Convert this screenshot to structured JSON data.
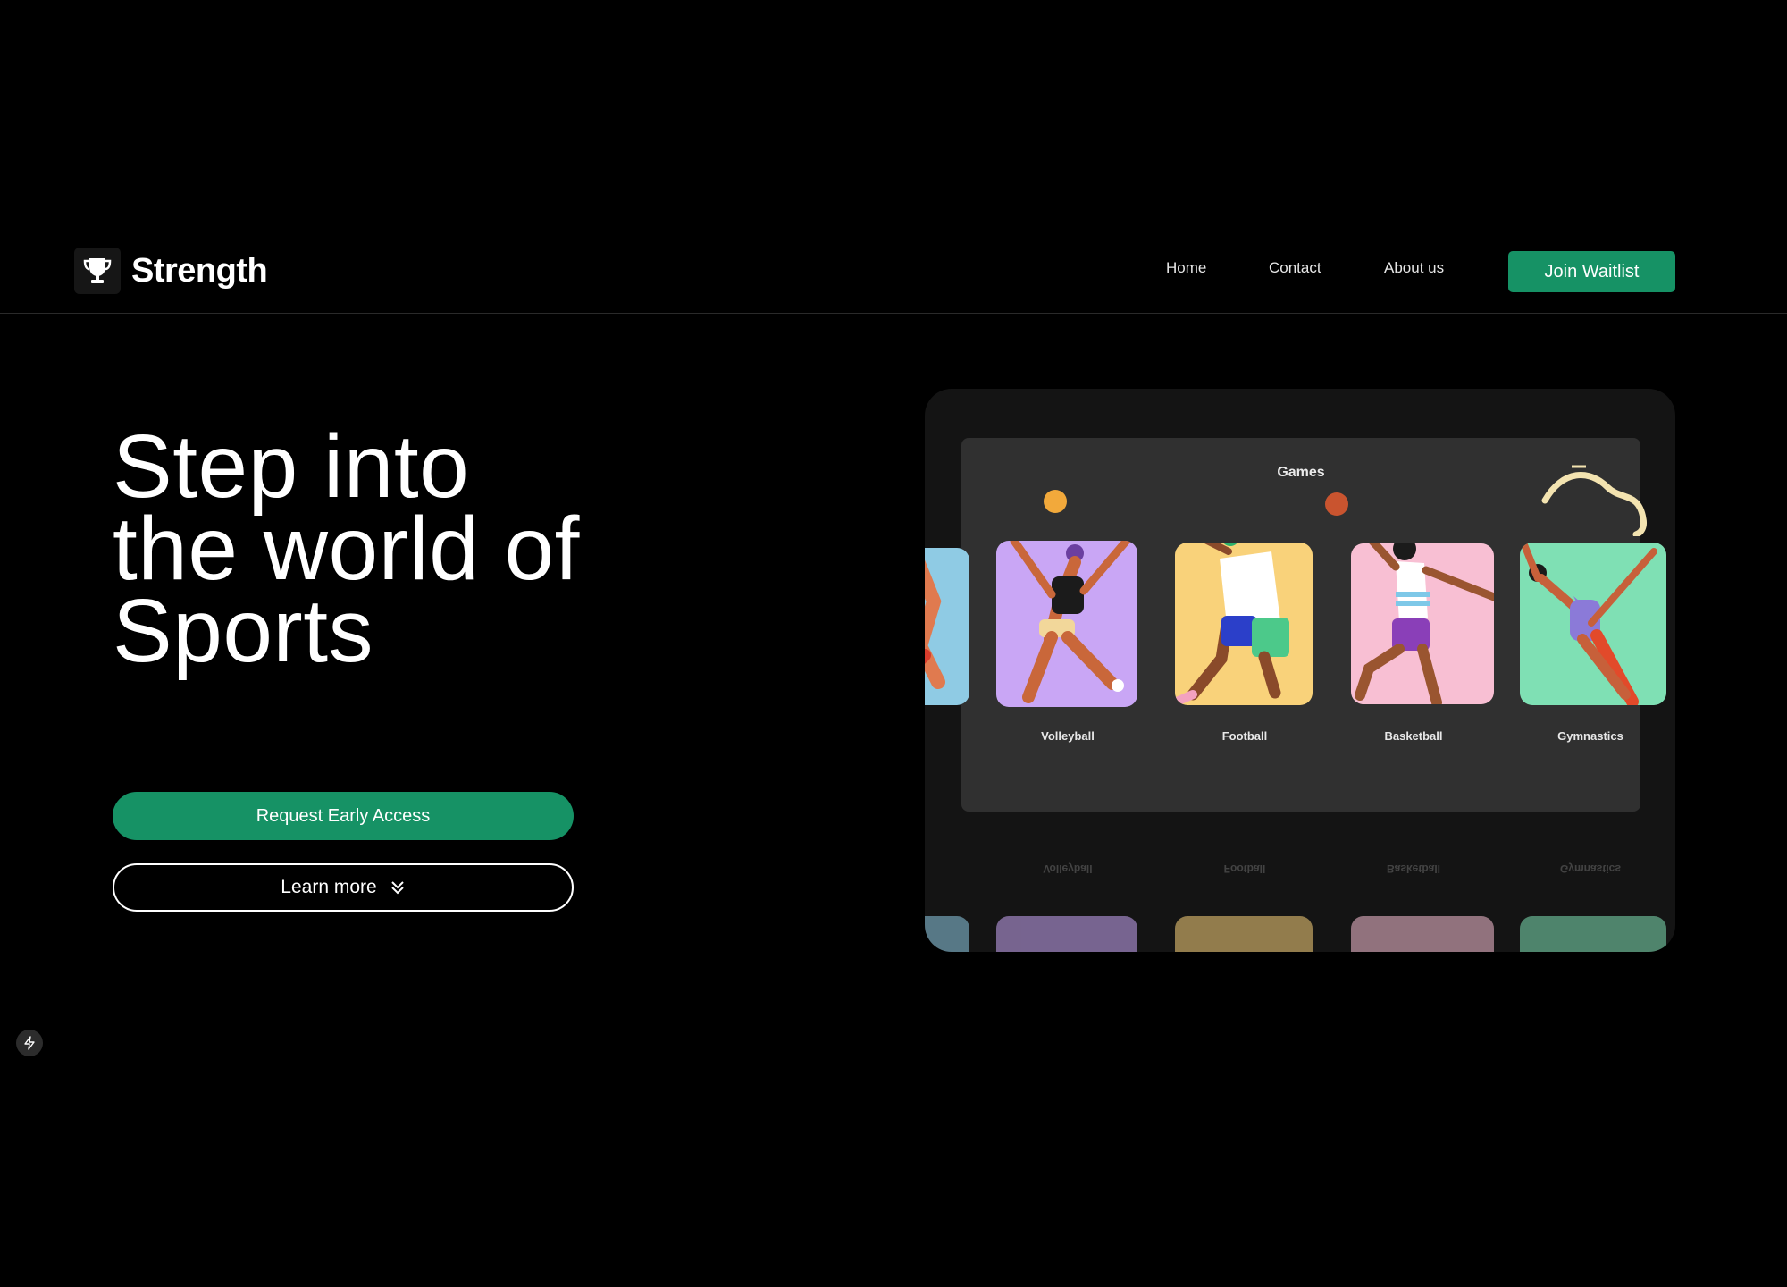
{
  "header": {
    "brand_name": "Strength",
    "brand_icon": "trophy-icon",
    "nav_links": [
      "Home",
      "Contact",
      "About us"
    ],
    "cta_label": "Join Waitlist"
  },
  "hero": {
    "title_lines": [
      "Step into",
      "the world of",
      "Sports"
    ],
    "primary_cta": "Request Early Access",
    "secondary_cta": "Learn more",
    "secondary_cta_icon": "double-chevron-down-icon"
  },
  "preview": {
    "panel_title": "Games",
    "games": [
      "Volleyball",
      "Football",
      "Basketball",
      "Gymnastics"
    ]
  },
  "corner_badge_icon": "lightning-bolt-icon",
  "colors": {
    "accent": "#169265",
    "background": "#000000",
    "card": "#141414",
    "panel": "#303030",
    "volleyball_tile": "#c9a6f5",
    "football_tile": "#f9d27a",
    "basketball_tile": "#f8bfd3",
    "gymnastics_tile": "#7fe0b4",
    "partial_tile": "#8fcbe4"
  }
}
